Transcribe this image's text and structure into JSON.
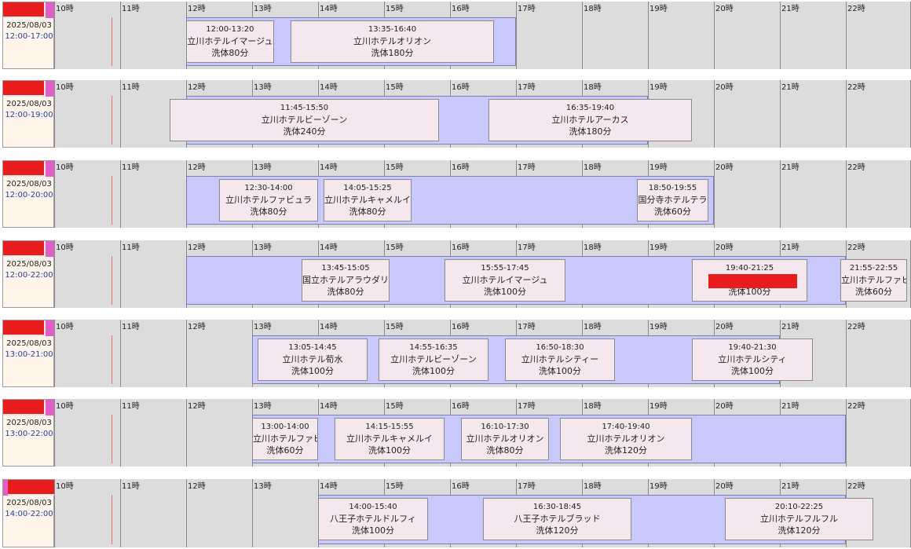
{
  "hours": [
    "10時",
    "11時",
    "12時",
    "13時",
    "14時",
    "15時",
    "16時",
    "17時",
    "18時",
    "19時",
    "20時",
    "21時",
    "22時"
  ],
  "colors": {
    "band": "#c8c8fa",
    "booking": "#f4e8ee",
    "grid": "#dcdcdc",
    "left": "#fff5ea",
    "redact": "#e81c1c"
  },
  "rows": [
    {
      "date": "2025/08/03",
      "range": "12:00-17:00",
      "band": [
        12,
        17
      ],
      "bookings": [
        {
          "time": "12:00-13:20",
          "hotel": "立川ホテルイマージュ",
          "duration": "洗体80分",
          "s": 12,
          "e": 13.33
        },
        {
          "time": "13:35-16:40",
          "hotel": "立川ホテルオリオン",
          "duration": "洗体180分",
          "s": 13.583,
          "e": 16.667
        }
      ]
    },
    {
      "date": "2025/08/03",
      "range": "12:00-19:00",
      "band": [
        12,
        19
      ],
      "bookings": [
        {
          "time": "11:45-15:50",
          "hotel": "立川ホテルビーゾーン",
          "duration": "洗体240分",
          "s": 11.75,
          "e": 15.833
        },
        {
          "time": "16:35-19:40",
          "hotel": "立川ホテルアーカス",
          "duration": "洗体180分",
          "s": 16.583,
          "e": 19.667
        }
      ]
    },
    {
      "date": "2025/08/03",
      "range": "12:00-20:00",
      "band": [
        12,
        20
      ],
      "bookings": [
        {
          "time": "12:30-14:00",
          "hotel": "立川ホテルファビュラ",
          "duration": "洗体80分",
          "s": 12.5,
          "e": 14
        },
        {
          "time": "14:05-15:25",
          "hotel": "立川ホテルキャメルイ",
          "duration": "洗体80分",
          "s": 14.083,
          "e": 15.417
        },
        {
          "time": "18:50-19:55",
          "hotel": "国分寺ホテルテラ",
          "duration": "洗体60分",
          "s": 18.833,
          "e": 19.917
        }
      ]
    },
    {
      "date": "2025/08/03",
      "range": "12:00-22:00",
      "band": [
        12,
        22
      ],
      "bookings": [
        {
          "time": "13:45-15:05",
          "hotel": "国立ホテルアラウダリ",
          "duration": "洗体80分",
          "s": 13.75,
          "e": 15.083
        },
        {
          "time": "15:55-17:45",
          "hotel": "立川ホテルイマージュ",
          "duration": "洗体100分",
          "s": 15.917,
          "e": 17.75
        },
        {
          "time": "19:40-21:25",
          "hotel": "",
          "duration": "洗体100分",
          "s": 19.667,
          "e": 21.417,
          "redacted": true
        },
        {
          "time": "21:55-22:55",
          "hotel": "立川ホテルファビ",
          "duration": "洗体60分",
          "s": 21.917,
          "e": 22.93
        }
      ]
    },
    {
      "date": "2025/08/03",
      "range": "13:00-21:00",
      "band": [
        13,
        21
      ],
      "bookings": [
        {
          "time": "13:05-14:45",
          "hotel": "立川ホテル荀水",
          "duration": "洗体100分",
          "s": 13.083,
          "e": 14.75
        },
        {
          "time": "14:55-16:35",
          "hotel": "立川ホテルビーゾーン",
          "duration": "洗体100分",
          "s": 14.917,
          "e": 16.583
        },
        {
          "time": "16:50-18:30",
          "hotel": "立川ホテルシティー",
          "duration": "洗体100分",
          "s": 16.833,
          "e": 18.5
        },
        {
          "time": "19:40-21:30",
          "hotel": "立川ホテルシティ",
          "duration": "洗体100分",
          "s": 19.667,
          "e": 21.5
        }
      ]
    },
    {
      "date": "2025/08/03",
      "range": "13:00-22:00",
      "band": [
        13,
        22
      ],
      "bookings": [
        {
          "time": "13:00-14:00",
          "hotel": "立川ホテルファビ",
          "duration": "洗体60分",
          "s": 13,
          "e": 14
        },
        {
          "time": "14:15-15:55",
          "hotel": "立川ホテルキャメルイ",
          "duration": "洗体100分",
          "s": 14.25,
          "e": 15.917
        },
        {
          "time": "16:10-17:30",
          "hotel": "立川ホテルオリオン",
          "duration": "洗体80分",
          "s": 16.167,
          "e": 17.5
        },
        {
          "time": "17:40-19:40",
          "hotel": "立川ホテルオリオン",
          "duration": "洗体120分",
          "s": 17.667,
          "e": 19.667
        }
      ]
    },
    {
      "date": "2025/08/03",
      "range": "14:00-22:00",
      "band": [
        14,
        22
      ],
      "bookings": [
        {
          "time": "14:00-15:40",
          "hotel": "八王子ホテルドルフィ",
          "duration": "洗体100分",
          "s": 14,
          "e": 15.667
        },
        {
          "time": "16:30-18:45",
          "hotel": "八王子ホテルブラッド",
          "duration": "洗体120分",
          "s": 16.5,
          "e": 18.75
        },
        {
          "time": "20:10-22:25",
          "hotel": "立川ホテルフルフル",
          "duration": "洗体120分",
          "s": 20.167,
          "e": 22.417
        }
      ]
    }
  ]
}
